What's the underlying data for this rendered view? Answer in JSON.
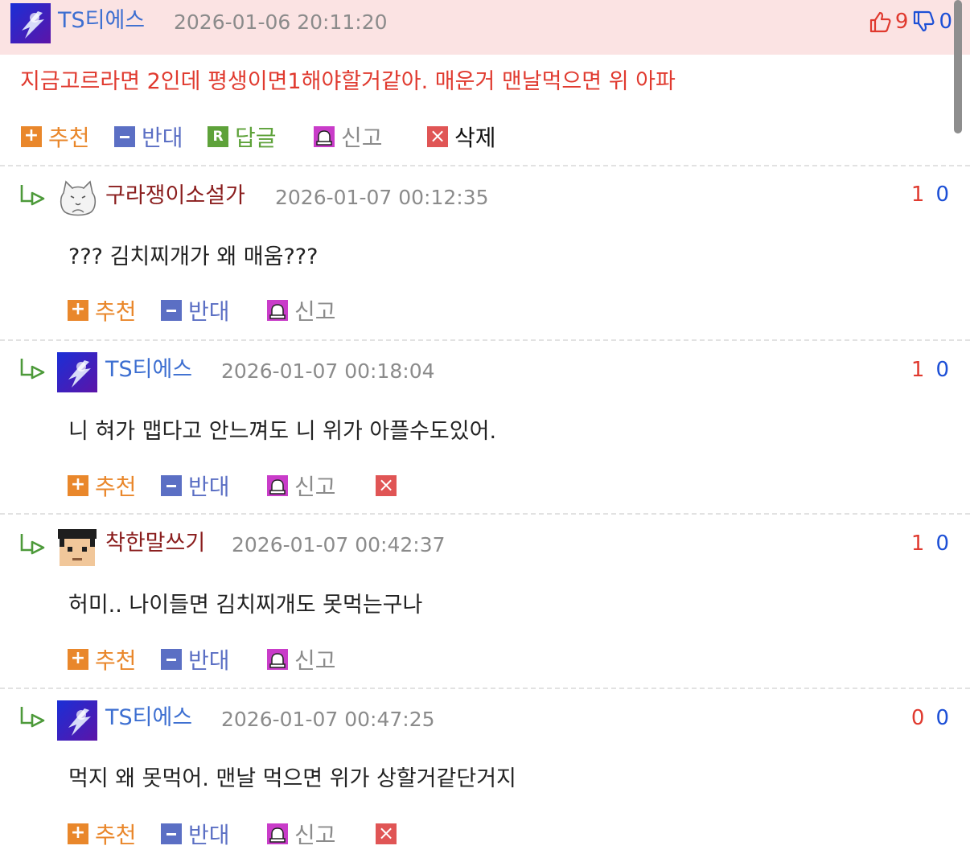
{
  "original": {
    "author": "TS티에스",
    "timestamp": "2026-01-06 20:11:20",
    "up_votes": "9",
    "down_votes": "0",
    "text": "지금고르라면 2인데 평생이면1해야할거같아. 매운거 맨날먹으면 위 아파",
    "actions": {
      "recommend": "추천",
      "oppose": "반대",
      "reply": "답글",
      "report": "신고",
      "delete": "삭제"
    }
  },
  "replies": [
    {
      "author": "구라쟁이소설가",
      "timestamp": "2026-01-07 00:12:35",
      "up": "1",
      "down": "0",
      "text": "??? 김치찌개가 왜 매움???",
      "actions": {
        "recommend": "추천",
        "oppose": "반대",
        "report": "신고"
      }
    },
    {
      "author": "TS티에스",
      "timestamp": "2026-01-07 00:18:04",
      "up": "1",
      "down": "0",
      "text": "니 혀가 맵다고 안느껴도 니 위가 아플수도있어.",
      "actions": {
        "recommend": "추천",
        "oppose": "반대",
        "report": "신고"
      }
    },
    {
      "author": "착한말쓰기",
      "timestamp": "2026-01-07 00:42:37",
      "up": "1",
      "down": "0",
      "text": "허미.. 나이들면 김치찌개도 못먹는구나",
      "actions": {
        "recommend": "추천",
        "oppose": "반대",
        "report": "신고"
      }
    },
    {
      "author": "TS티에스",
      "timestamp": "2026-01-07 00:47:25",
      "up": "0",
      "down": "0",
      "text": "먹지 왜 못먹어. 맨날 먹으면 위가 상할거같단거지",
      "actions": {
        "recommend": "추천",
        "oppose": "반대",
        "report": "신고"
      }
    }
  ],
  "colors": {
    "header_bg": "#fbe3e3",
    "author_blue": "#3d6fd1",
    "author_dark_red": "#8a1d1d",
    "original_text_red": "#e03a2f",
    "upvote_red": "#e03a2f",
    "downvote_blue": "#1c4fd6",
    "recommend_orange": "#e9872b",
    "oppose_blue": "#5b6fc4",
    "reply_green": "#5ea23a",
    "report_magenta": "#c93cc9",
    "delete_red": "#e05555"
  },
  "icons": {
    "thumbs_up": "thumbs-up-icon",
    "thumbs_down": "thumbs-down-icon",
    "reply_arrow": "reply-arrow-icon",
    "recommend": "plus-icon",
    "oppose": "minus-icon",
    "reply": "reply-r-icon",
    "report": "siren-icon",
    "delete": "close-icon"
  }
}
